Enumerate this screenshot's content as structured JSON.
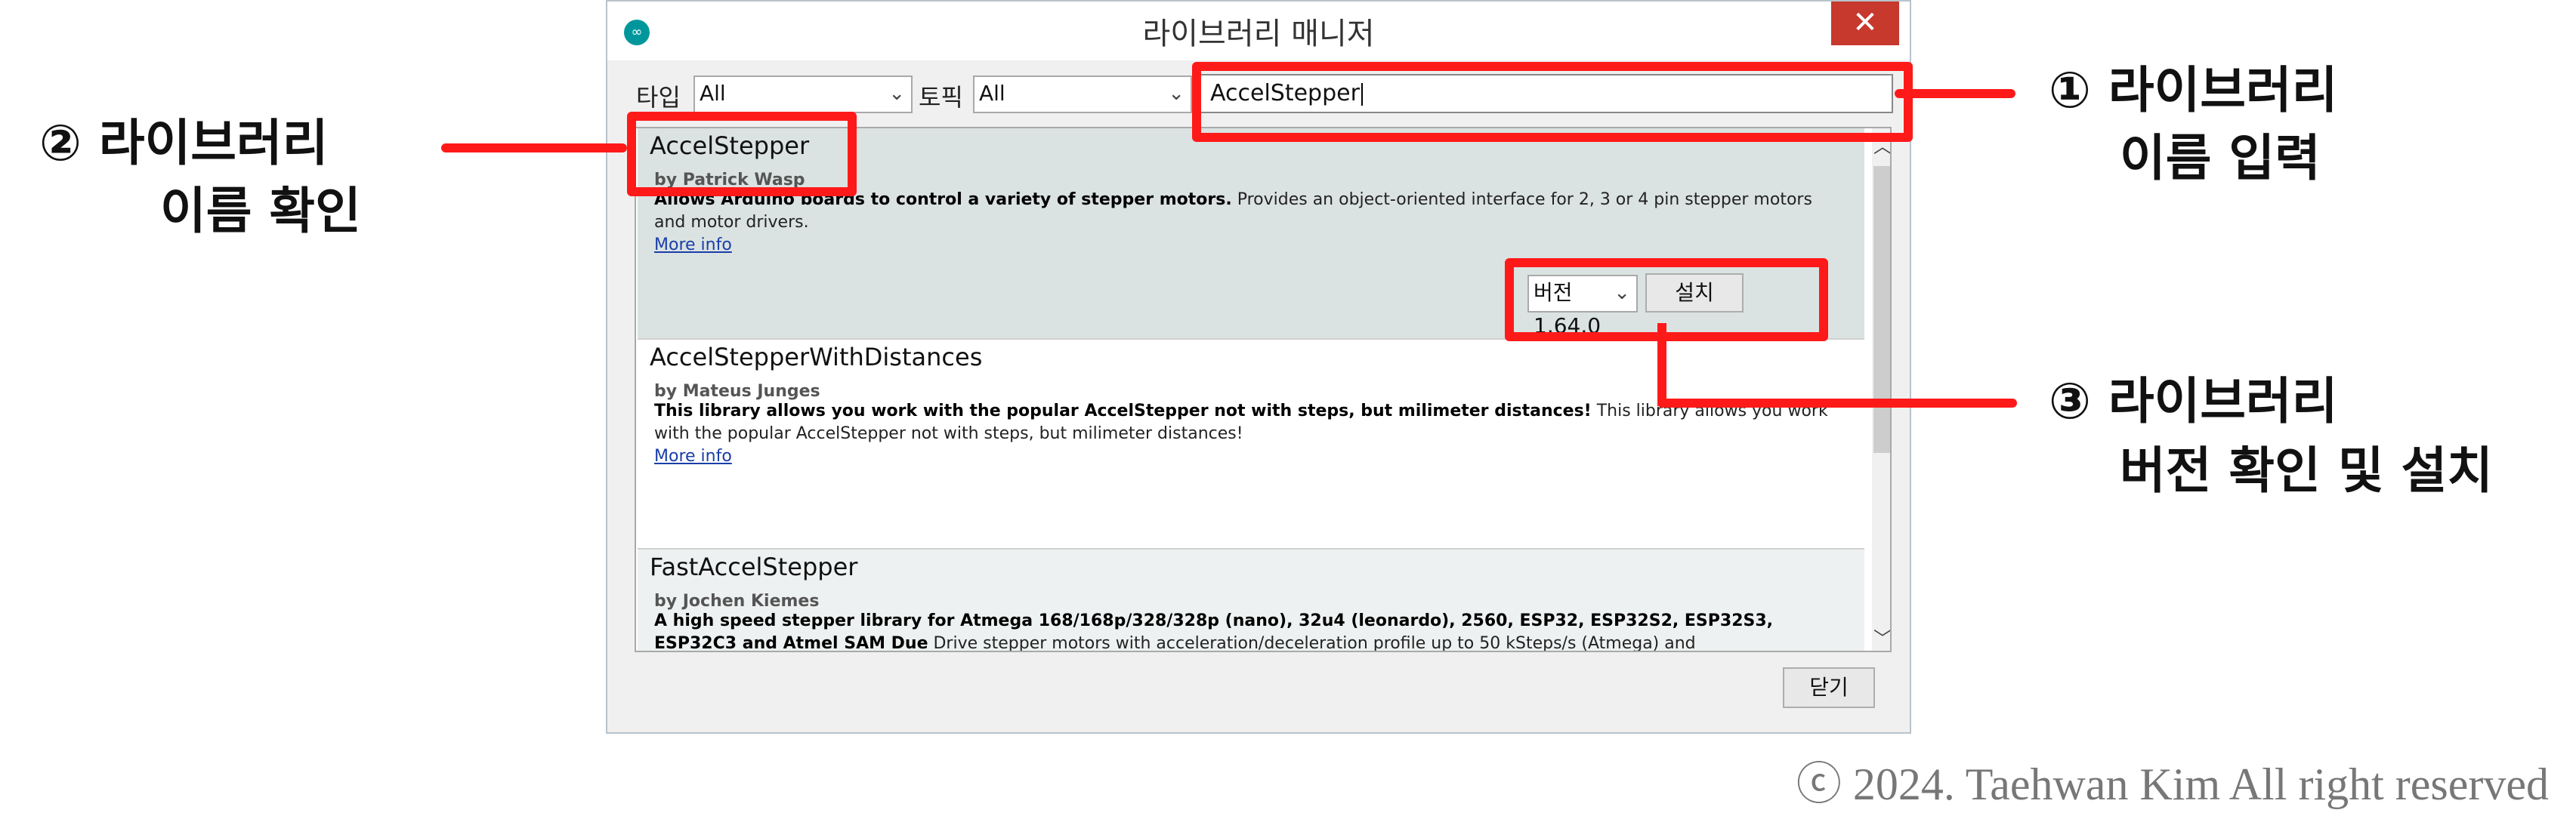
{
  "window": {
    "title": "라이브러리 매니저",
    "close_glyph": "✕",
    "app_icon_glyph": "∞"
  },
  "filters": {
    "type_label": "타입",
    "type_value": "All",
    "topic_label": "토픽",
    "topic_value": "All",
    "search_value": "AccelStepper"
  },
  "libraries": [
    {
      "name": "AccelStepper",
      "author": "by Patrick Wasp",
      "desc_bold": "Allows Arduino boards to control a variety of stepper motors.",
      "desc": " Provides an object-oriented interface for 2, 3 or 4 pin stepper motors and motor drivers.",
      "more_info": "More info",
      "version": "버전 1.64.0",
      "install_label": "설치"
    },
    {
      "name": "AccelStepperWithDistances",
      "author": "by Mateus Junges",
      "desc_bold": "This library allows you work with the popular AccelStepper not with steps, but milimeter distances!",
      "desc": " This library allows you work with the popular AccelStepper not with steps, but milimeter distances!",
      "more_info": "More info"
    },
    {
      "name": "FastAccelStepper",
      "author": "by Jochen Kiemes",
      "desc_bold": "A high speed stepper library for Atmega 168/168p/328/328p (nano), 32u4 (leonardo), 2560, ESP32, ESP32S2, ESP32S3, ESP32C3 and Atmel SAM Due",
      "desc": " Drive stepper motors with acceleration/deceleration profile up to 50 kSteps/s (Atmega) and"
    }
  ],
  "footer": {
    "close_label": "닫기"
  },
  "annotations": {
    "a1_line1": "① 라이브러리",
    "a1_line2": "이름 입력",
    "a2_line1": "② 라이브러리",
    "a2_line2": "이름 확인",
    "a3_line1": "③ 라이브러리",
    "a3_line2": "버전 확인 및 설치"
  },
  "copyright": "ⓒ 2024. Taehwan Kim All right reserved",
  "colors": {
    "highlight": "#ff1a1a",
    "selected_item_bg": "#dbe3e2",
    "link": "#1a3ea8"
  }
}
